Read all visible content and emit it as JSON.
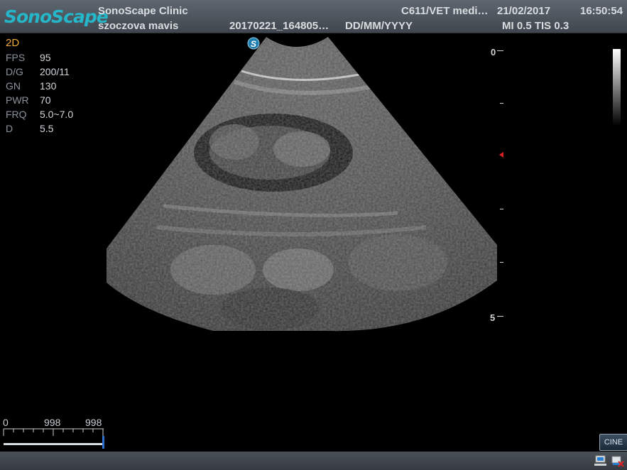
{
  "header": {
    "logo": "SonoScape",
    "clinic": "SonoScape Clinic",
    "patient_name": "szoczova mavis",
    "study_id": "20170221_164805…",
    "date_format": "DD/MM/YYYY",
    "device": "C611/VET medi…",
    "date": "21/02/2017",
    "time": "16:50:54",
    "indices": "MI 0.5 TIS 0.3"
  },
  "params": {
    "mode": "2D",
    "rows": [
      {
        "label": "FPS",
        "value": "95"
      },
      {
        "label": "D/G",
        "value": "200/11"
      },
      {
        "label": "GN",
        "value": "130"
      },
      {
        "label": "PWR",
        "value": "70"
      },
      {
        "label": "FRQ",
        "value": "5.0~7.0"
      },
      {
        "label": "D",
        "value": "5.5"
      }
    ]
  },
  "depth_scale": {
    "top_label": "0",
    "bottom_label": "5",
    "focus_marker_color": "#e02020"
  },
  "probe_marker": "S",
  "cine_scale": {
    "start": "0",
    "mid": "998",
    "end": "998"
  },
  "footer": {
    "cine_button": "CINE"
  },
  "colors": {
    "logo": "#25b6c9",
    "mode_label": "#f0a840",
    "probe_marker": "#1f7fb0"
  }
}
